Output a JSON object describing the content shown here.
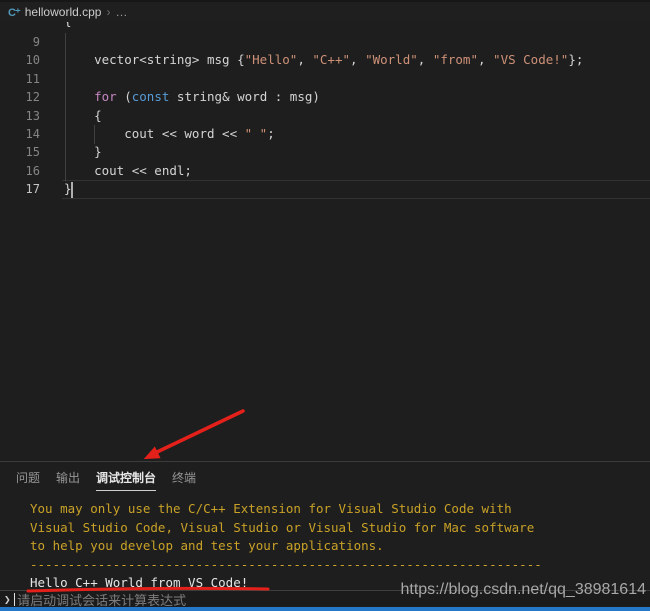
{
  "breadcrumb": {
    "icon_glyph": "C⁺",
    "file_name": "helloworld.cpp",
    "separator": "›",
    "ellipsis": "…"
  },
  "editor": {
    "clipped_prev_line_glyph": "{",
    "lines": [
      {
        "num": "9",
        "tokens": []
      },
      {
        "num": "10",
        "tokens": [
          {
            "t": "    vector<string> msg {",
            "c": "plain"
          },
          {
            "t": "\"Hello\"",
            "c": "string"
          },
          {
            "t": ", ",
            "c": "plain"
          },
          {
            "t": "\"C++\"",
            "c": "string"
          },
          {
            "t": ", ",
            "c": "plain"
          },
          {
            "t": "\"World\"",
            "c": "string"
          },
          {
            "t": ", ",
            "c": "plain"
          },
          {
            "t": "\"from\"",
            "c": "string"
          },
          {
            "t": ", ",
            "c": "plain"
          },
          {
            "t": "\"VS Code!\"",
            "c": "string"
          },
          {
            "t": "};",
            "c": "plain"
          }
        ]
      },
      {
        "num": "11",
        "tokens": []
      },
      {
        "num": "12",
        "tokens": [
          {
            "t": "    ",
            "c": "plain"
          },
          {
            "t": "for",
            "c": "kw-control"
          },
          {
            "t": " (",
            "c": "plain"
          },
          {
            "t": "const",
            "c": "kw"
          },
          {
            "t": " string& word : msg)",
            "c": "plain"
          }
        ]
      },
      {
        "num": "13",
        "tokens": [
          {
            "t": "    {",
            "c": "plain"
          }
        ]
      },
      {
        "num": "14",
        "tokens": [
          {
            "t": "        cout << word << ",
            "c": "plain"
          },
          {
            "t": "\" \"",
            "c": "string"
          },
          {
            "t": ";",
            "c": "plain"
          }
        ]
      },
      {
        "num": "15",
        "tokens": [
          {
            "t": "    }",
            "c": "plain"
          }
        ]
      },
      {
        "num": "16",
        "tokens": [
          {
            "t": "    cout << endl;",
            "c": "plain"
          }
        ]
      },
      {
        "num": "17",
        "tokens": [
          {
            "t": "}",
            "c": "plain"
          }
        ],
        "active": true,
        "cursor_after": true
      }
    ]
  },
  "panel": {
    "tabs": [
      {
        "label": "问题",
        "active": false
      },
      {
        "label": "输出",
        "active": false
      },
      {
        "label": "调试控制台",
        "active": true
      },
      {
        "label": "终端",
        "active": false
      }
    ],
    "console": {
      "warning_lines": [
        "You may only use the C/C++ Extension for Visual Studio Code with",
        "Visual Studio Code, Visual Studio or Visual Studio for Mac software",
        "to help you develop and test your applications."
      ],
      "separator_dashes": "--------------------------------------------------------------------",
      "output_line": "Hello C++ World from VS Code!",
      "prompt_glyph": "❯",
      "input_placeholder": "请启动调试会话来计算表达式"
    }
  },
  "watermark": "https://blog.csdn.net/qq_38981614",
  "colors": {
    "editor_bg": "#1e1e1e",
    "string": "#ce9178",
    "keyword": "#569cd6",
    "keyword_control": "#c586c0",
    "code_default": "#d4d4d4",
    "line_number": "#858585",
    "line_number_active": "#c6c6c6",
    "console_warning": "#c9a227",
    "console_output": "#e6e6e6",
    "tab_active": "#e7e7e7",
    "tab_inactive": "#969696",
    "annotation_red": "#e3211a",
    "bottom_bar_blue": "#2577c8",
    "cpp_icon_blue": "#519aba"
  }
}
